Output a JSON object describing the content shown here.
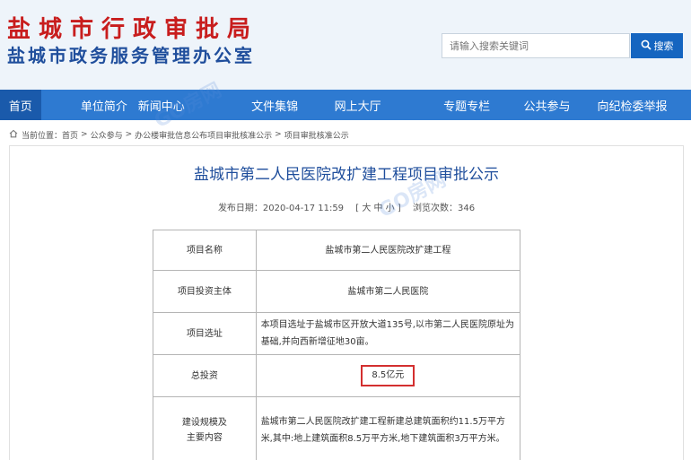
{
  "header": {
    "title_line1": "盐城市行政审批局",
    "title_line2": "盐城市政务服务管理办公室",
    "search_placeholder": "请输入搜索关键词",
    "search_button": "搜索"
  },
  "nav": {
    "items": [
      {
        "label": "首页",
        "active": true
      },
      {
        "label": "单位简介"
      },
      {
        "label": "新闻中心"
      },
      {
        "label": "文件集锦"
      },
      {
        "label": "网上大厅"
      },
      {
        "label": "专题专栏"
      },
      {
        "label": "公共参与"
      },
      {
        "label": "向纪检委举报"
      }
    ]
  },
  "breadcrumb": {
    "prefix": "当前位置：",
    "items": [
      "首页",
      "公众参与",
      "办公楼审批信息公布项目审批核准公示",
      "项目审批核准公示"
    ],
    "separator": ">"
  },
  "article": {
    "title": "盐城市第二人民医院改扩建工程项目审批公示",
    "date_label": "发布日期：2020-04-17 11:59",
    "font_size_control": "[ 大 中 小 ]",
    "views_label": "浏览次数：346"
  },
  "table": {
    "rows": [
      {
        "label": "项目名称",
        "value": "盐城市第二人民医院改扩建工程"
      },
      {
        "label": "项目投资主体",
        "value": "盐城市第二人民医院"
      },
      {
        "label": "项目选址",
        "value": "本项目选址于盐城市区开放大道135号,以市第二人民医院原址为基础,并向西新增征地30亩。"
      },
      {
        "label": "总投资",
        "value": "8.5亿元"
      },
      {
        "label_line1": "建设规模及",
        "label_line2": "主要内容",
        "value": "盐城市第二人民医院改扩建工程新建总建筑面积约11.5万平方米,其中:地上建筑面积8.5万平方米,地下建筑面积3万平方米。"
      }
    ]
  },
  "watermark": "GO房网",
  "colors": {
    "title_red": "#c81d1d",
    "title_blue": "#1f4e9c",
    "nav_bg": "#2e7ad1",
    "nav_active": "#1a5aab",
    "search_button": "#1565c0",
    "highlight_border": "#d32f2f"
  },
  "icons": {
    "search": "magnifier-icon",
    "breadcrumb_home": "home-icon"
  }
}
